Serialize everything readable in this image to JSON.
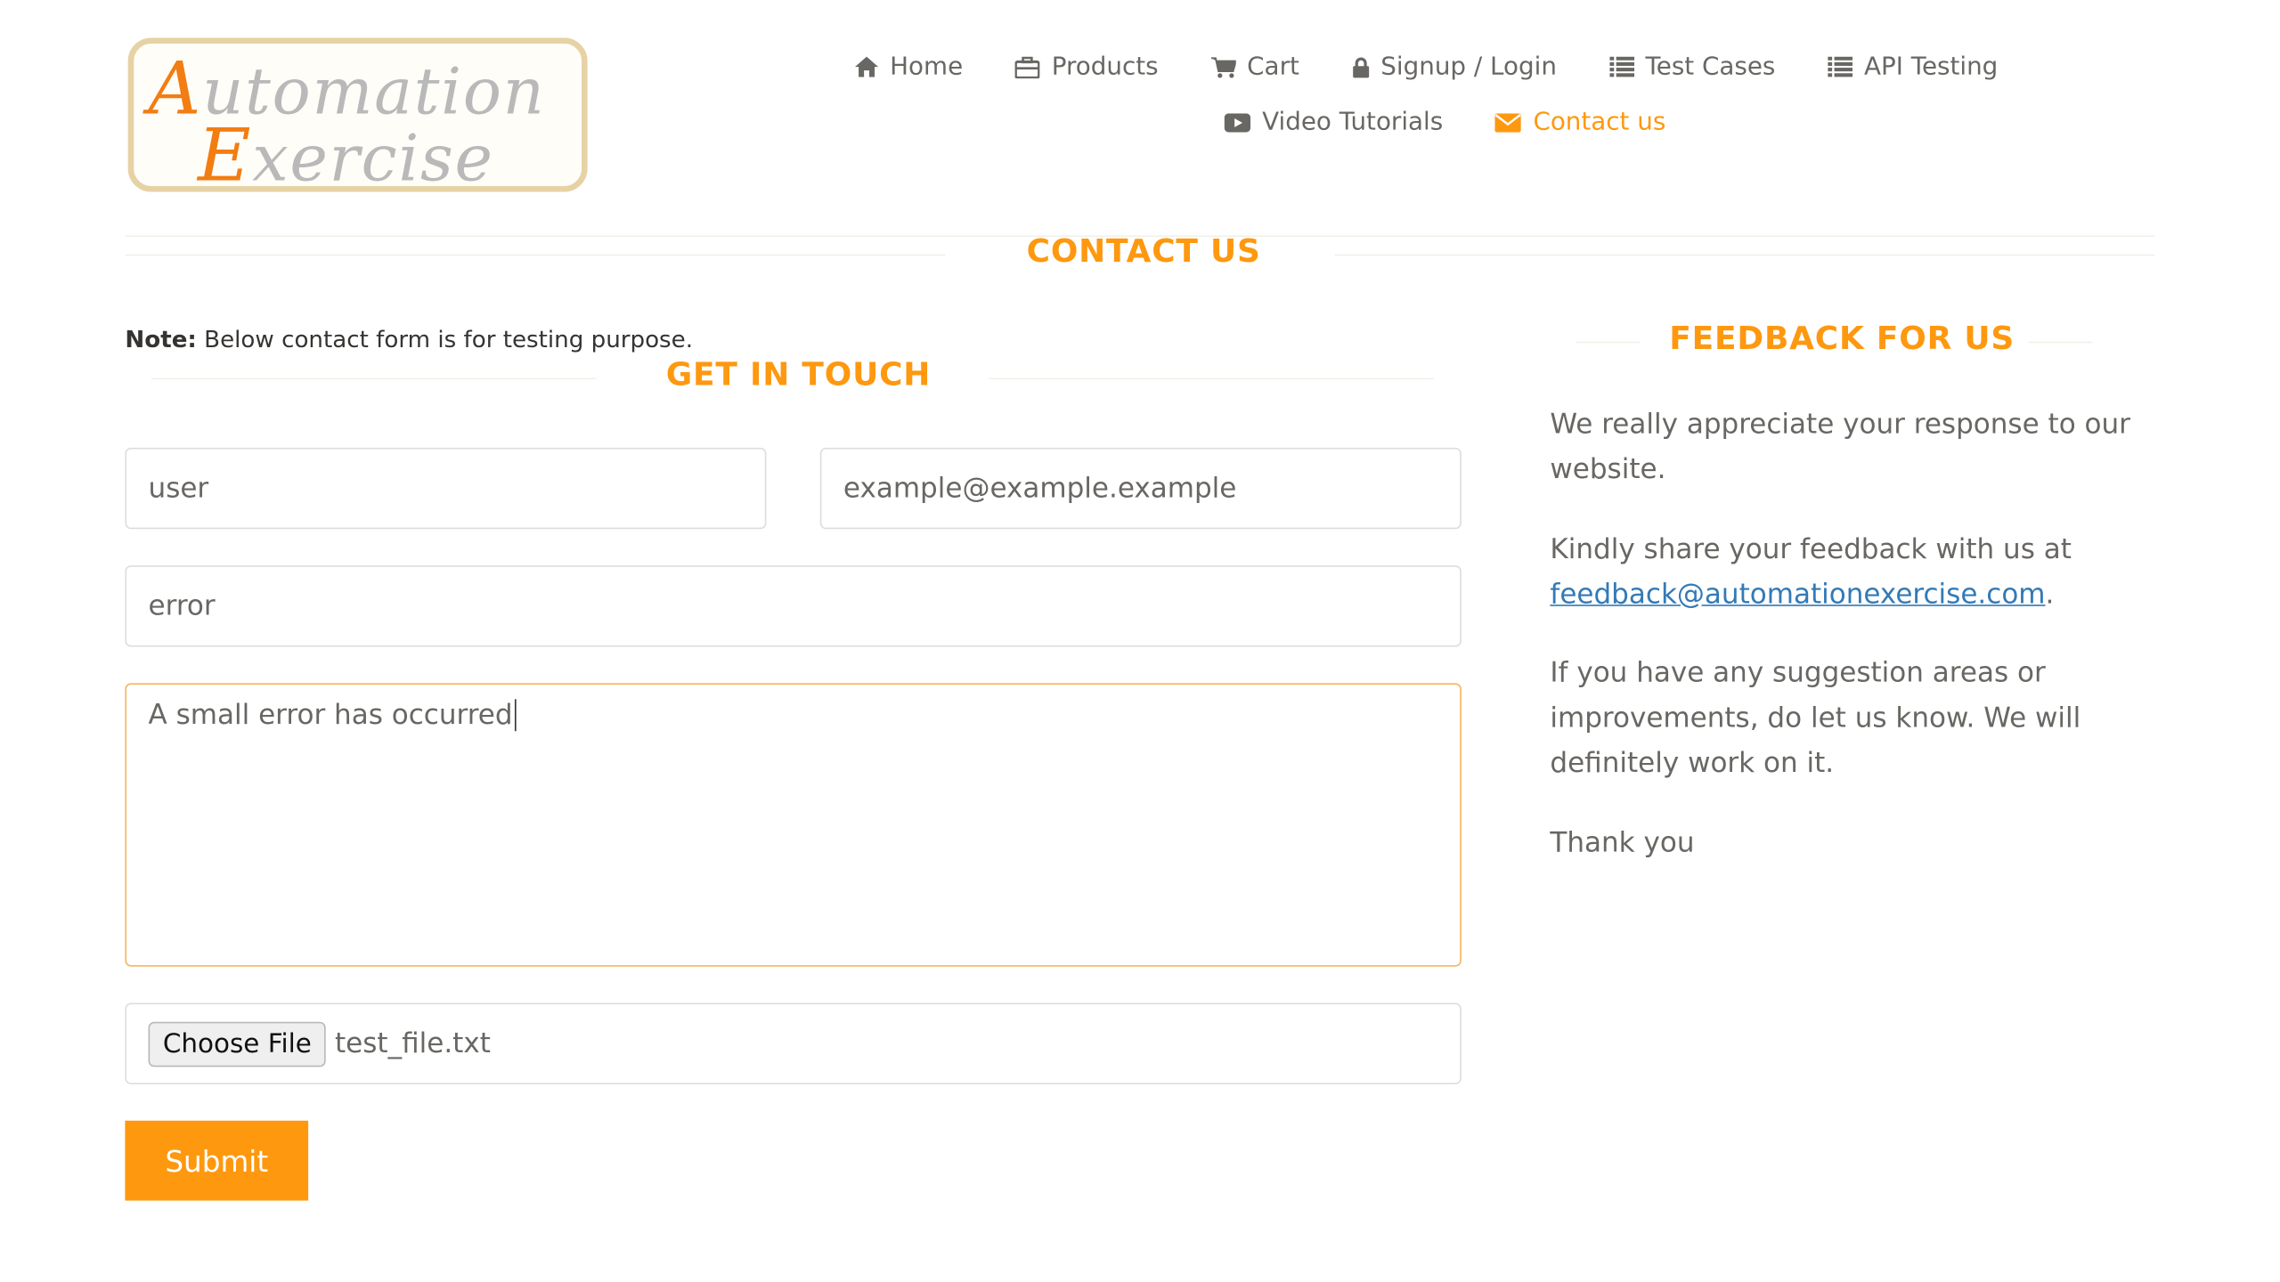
{
  "logo": {
    "line1_cap": "A",
    "line1_rest": "utomation",
    "line2_cap": "E",
    "line2_rest": "xercise"
  },
  "nav": {
    "items": [
      {
        "label": "Home",
        "icon": "home-icon"
      },
      {
        "label": "Products",
        "icon": "briefcase-icon"
      },
      {
        "label": "Cart",
        "icon": "cart-icon"
      },
      {
        "label": "Signup / Login",
        "icon": "lock-icon"
      },
      {
        "label": "Test Cases",
        "icon": "list-icon"
      },
      {
        "label": "API Testing",
        "icon": "list-icon"
      },
      {
        "label": "Video Tutorials",
        "icon": "youtube-play-icon"
      },
      {
        "label": "Contact us",
        "icon": "envelope-icon",
        "active": true
      }
    ]
  },
  "page": {
    "title": "CONTACT US"
  },
  "note": {
    "label": "Note:",
    "text": "Below contact form is for testing purpose."
  },
  "form": {
    "title": "GET IN TOUCH",
    "name_value": "user",
    "email_value": "example@example.example",
    "subject_value": "error",
    "message_value": "A small error has occurred",
    "file_button": "Choose File",
    "file_name": "test_file.txt",
    "submit_label": "Submit"
  },
  "feedback": {
    "title": "FEEDBACK FOR US",
    "p1": "We really appreciate your response to our website.",
    "p2_prefix": "Kindly share your feedback with us at",
    "p2_link": "feedback@automationexercise.com",
    "p2_suffix": ".",
    "p3": "If you have any suggestion areas or improvements, do let us know. We will definitely work on it.",
    "p4": "Thank you"
  },
  "colors": {
    "accent": "#fe980f",
    "text": "#696763",
    "link": "#337ab7"
  }
}
